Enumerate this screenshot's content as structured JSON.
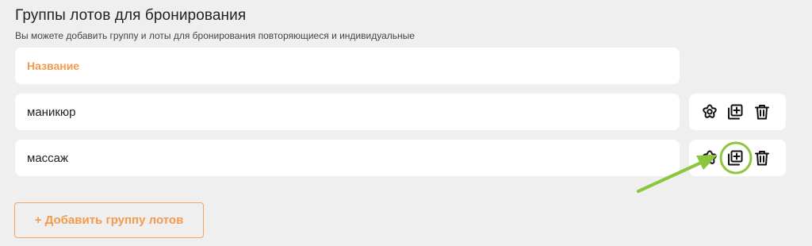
{
  "section": {
    "title": "Группы лотов для бронирования",
    "subtitle": "Вы можете добавить группу и лоты для бронирования повторяющиеся и индивидуальные"
  },
  "table": {
    "header_label": "Название",
    "rows": [
      {
        "name": "маникюр",
        "actions": [
          "settings-icon",
          "add-lot-icon",
          "delete-icon"
        ]
      },
      {
        "name": "массаж",
        "actions": [
          "settings-icon",
          "add-lot-icon",
          "delete-icon"
        ]
      }
    ]
  },
  "add_group_button": {
    "label": "+ Добавить группу лотов"
  },
  "colors": {
    "accent": "#f39a4e",
    "annotation": "#8cc63f",
    "background": "#efefef",
    "card": "#ffffff"
  }
}
